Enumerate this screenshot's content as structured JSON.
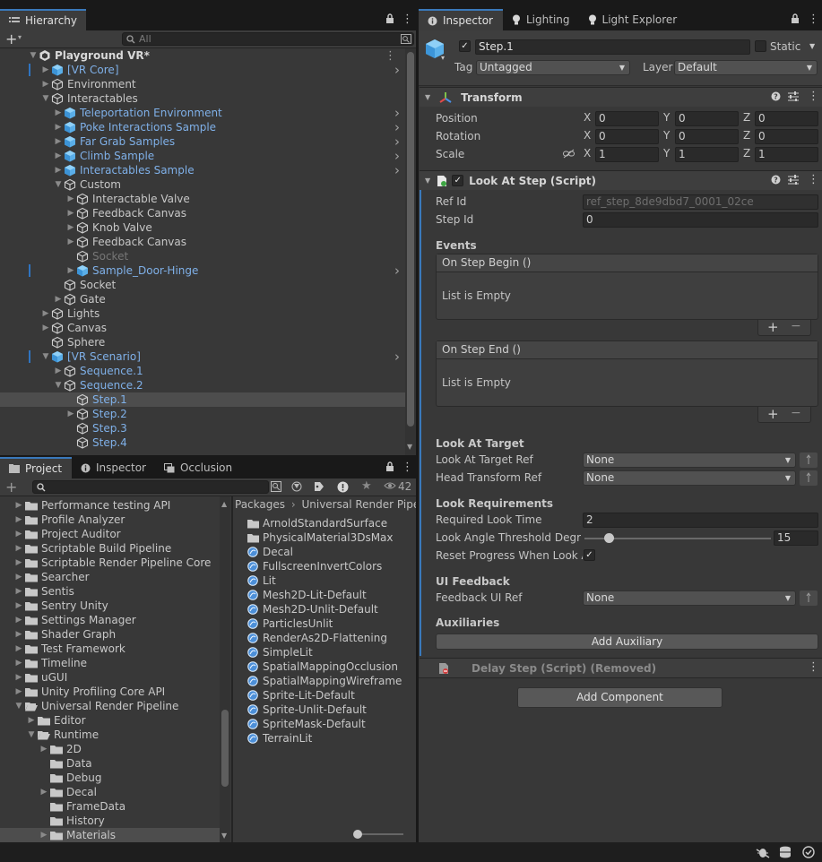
{
  "hierarchy": {
    "tab_label": "Hierarchy",
    "search_placeholder": "All",
    "scene_name": "Playground VR*",
    "rows": [
      {
        "label": "[VR Core]",
        "indent": 1,
        "expand": "closed",
        "icon": "prefab",
        "color": "blue",
        "chevron": true,
        "marker": true
      },
      {
        "label": "Environment",
        "indent": 1,
        "expand": "closed",
        "icon": "object",
        "color": "normal"
      },
      {
        "label": "Interactables",
        "indent": 1,
        "expand": "open",
        "icon": "object",
        "color": "normal"
      },
      {
        "label": "Teleportation Environment",
        "indent": 2,
        "expand": "closed",
        "icon": "prefab",
        "color": "blue",
        "chevron": true
      },
      {
        "label": "Poke Interactions Sample",
        "indent": 2,
        "expand": "closed",
        "icon": "prefab",
        "color": "blue",
        "chevron": true
      },
      {
        "label": "Far Grab Samples",
        "indent": 2,
        "expand": "closed",
        "icon": "prefab",
        "color": "blue",
        "chevron": true
      },
      {
        "label": "Climb Sample",
        "indent": 2,
        "expand": "closed",
        "icon": "prefab",
        "color": "blue",
        "chevron": true
      },
      {
        "label": "Interactables Sample",
        "indent": 2,
        "expand": "closed",
        "icon": "prefab",
        "color": "blue",
        "chevron": true
      },
      {
        "label": "Custom",
        "indent": 2,
        "expand": "open",
        "icon": "object",
        "color": "normal"
      },
      {
        "label": "Interactable Valve",
        "indent": 3,
        "expand": "closed",
        "icon": "object",
        "color": "normal"
      },
      {
        "label": "Feedback Canvas",
        "indent": 3,
        "expand": "closed",
        "icon": "object",
        "color": "normal"
      },
      {
        "label": "Knob Valve",
        "indent": 3,
        "expand": "closed",
        "icon": "object",
        "color": "normal"
      },
      {
        "label": "Feedback Canvas",
        "indent": 3,
        "expand": "closed",
        "icon": "object",
        "color": "normal"
      },
      {
        "label": "Socket",
        "indent": 3,
        "expand": "none",
        "icon": "object",
        "color": "dim"
      },
      {
        "label": "Sample_Door-Hinge",
        "indent": 3,
        "expand": "closed",
        "icon": "prefab",
        "color": "blue",
        "chevron": true,
        "marker": true
      },
      {
        "label": "Socket",
        "indent": 2,
        "expand": "none",
        "icon": "object",
        "color": "normal"
      },
      {
        "label": "Gate",
        "indent": 2,
        "expand": "closed",
        "icon": "object",
        "color": "normal"
      },
      {
        "label": "Lights",
        "indent": 1,
        "expand": "closed",
        "icon": "object",
        "color": "normal"
      },
      {
        "label": "Canvas",
        "indent": 1,
        "expand": "closed",
        "icon": "object",
        "color": "normal"
      },
      {
        "label": "Sphere",
        "indent": 1,
        "expand": "none",
        "icon": "object",
        "color": "normal"
      },
      {
        "label": "[VR Scenario]",
        "indent": 1,
        "expand": "open",
        "icon": "prefab",
        "color": "blue",
        "chevron": true,
        "marker": true
      },
      {
        "label": "Sequence.1",
        "indent": 2,
        "expand": "closed",
        "icon": "object",
        "color": "blue"
      },
      {
        "label": "Sequence.2",
        "indent": 2,
        "expand": "open",
        "icon": "object",
        "color": "blue"
      },
      {
        "label": "Step.1",
        "indent": 3,
        "expand": "none",
        "icon": "object",
        "color": "blue",
        "selected": true
      },
      {
        "label": "Step.2",
        "indent": 3,
        "expand": "closed",
        "icon": "object",
        "color": "blue"
      },
      {
        "label": "Step.3",
        "indent": 3,
        "expand": "none",
        "icon": "object",
        "color": "blue"
      },
      {
        "label": "Step.4",
        "indent": 3,
        "expand": "none",
        "icon": "object",
        "color": "blue"
      }
    ]
  },
  "bottom_tabs": {
    "project": "Project",
    "inspector": "Inspector",
    "occlusion": "Occlusion"
  },
  "project": {
    "badge_count": "42",
    "tree": [
      {
        "label": "Performance testing API",
        "indent": 0,
        "expand": "closed"
      },
      {
        "label": "Profile Analyzer",
        "indent": 0,
        "expand": "closed"
      },
      {
        "label": "Project Auditor",
        "indent": 0,
        "expand": "closed"
      },
      {
        "label": "Scriptable Build Pipeline",
        "indent": 0,
        "expand": "closed"
      },
      {
        "label": "Scriptable Render Pipeline Core",
        "indent": 0,
        "expand": "closed"
      },
      {
        "label": "Searcher",
        "indent": 0,
        "expand": "closed"
      },
      {
        "label": "Sentis",
        "indent": 0,
        "expand": "closed"
      },
      {
        "label": "Sentry Unity",
        "indent": 0,
        "expand": "closed"
      },
      {
        "label": "Settings Manager",
        "indent": 0,
        "expand": "closed"
      },
      {
        "label": "Shader Graph",
        "indent": 0,
        "expand": "closed"
      },
      {
        "label": "Test Framework",
        "indent": 0,
        "expand": "closed"
      },
      {
        "label": "Timeline",
        "indent": 0,
        "expand": "closed"
      },
      {
        "label": "uGUI",
        "indent": 0,
        "expand": "closed"
      },
      {
        "label": "Unity Profiling Core API",
        "indent": 0,
        "expand": "closed"
      },
      {
        "label": "Universal Render Pipeline",
        "indent": 0,
        "expand": "open"
      },
      {
        "label": "Editor",
        "indent": 1,
        "expand": "closed"
      },
      {
        "label": "Runtime",
        "indent": 1,
        "expand": "open"
      },
      {
        "label": "2D",
        "indent": 2,
        "expand": "closed"
      },
      {
        "label": "Data",
        "indent": 2,
        "expand": "none"
      },
      {
        "label": "Debug",
        "indent": 2,
        "expand": "none"
      },
      {
        "label": "Decal",
        "indent": 2,
        "expand": "closed"
      },
      {
        "label": "FrameData",
        "indent": 2,
        "expand": "none"
      },
      {
        "label": "History",
        "indent": 2,
        "expand": "none"
      },
      {
        "label": "Materials",
        "indent": 2,
        "expand": "closed",
        "selected": true
      }
    ],
    "breadcrumb": [
      "Packages",
      "Universal Render Pipeli"
    ],
    "breadcrumb_sep": "›",
    "assets": [
      {
        "label": "ArnoldStandardSurface",
        "icon": "folder"
      },
      {
        "label": "PhysicalMaterial3DsMax",
        "icon": "folder"
      },
      {
        "label": "Decal",
        "icon": "shader"
      },
      {
        "label": "FullscreenInvertColors",
        "icon": "shader"
      },
      {
        "label": "Lit",
        "icon": "shader"
      },
      {
        "label": "Mesh2D-Lit-Default",
        "icon": "shader"
      },
      {
        "label": "Mesh2D-Unlit-Default",
        "icon": "shader"
      },
      {
        "label": "ParticlesUnlit",
        "icon": "shader"
      },
      {
        "label": "RenderAs2D-Flattening",
        "icon": "shader"
      },
      {
        "label": "SimpleLit",
        "icon": "shader"
      },
      {
        "label": "SpatialMappingOcclusion",
        "icon": "shader"
      },
      {
        "label": "SpatialMappingWireframe",
        "icon": "shader"
      },
      {
        "label": "Sprite-Lit-Default",
        "icon": "shader"
      },
      {
        "label": "Sprite-Unlit-Default",
        "icon": "shader"
      },
      {
        "label": "SpriteMask-Default",
        "icon": "shader"
      },
      {
        "label": "TerrainLit",
        "icon": "shader"
      }
    ]
  },
  "inspector": {
    "tabs": {
      "inspector": "Inspector",
      "lighting": "Lighting",
      "light_explorer": "Light Explorer"
    },
    "object_name": "Step.1",
    "static_label": "Static",
    "tag_label": "Tag",
    "tag_value": "Untagged",
    "layer_label": "Layer",
    "layer_value": "Default",
    "transform": {
      "title": "Transform",
      "rows": [
        {
          "label": "Position",
          "x": "0",
          "y": "0",
          "z": "0"
        },
        {
          "label": "Rotation",
          "x": "0",
          "y": "0",
          "z": "0"
        },
        {
          "label": "Scale",
          "x": "1",
          "y": "1",
          "z": "1"
        }
      ],
      "axis_labels": [
        "X",
        "Y",
        "Z"
      ]
    },
    "look_at_step": {
      "title": "Look At Step (Script)",
      "ref_id_label": "Ref Id",
      "ref_id_value": "ref_step_8de9dbd7_0001_02ce",
      "step_id_label": "Step Id",
      "step_id_value": "0",
      "events_label": "Events",
      "on_step_begin": "On Step Begin ()",
      "on_step_end": "On Step End ()",
      "list_empty": "List is Empty",
      "plus": "+",
      "minus": "−",
      "look_at_target_header": "Look At Target",
      "look_at_target_ref_label": "Look At Target Ref",
      "look_at_target_ref_value": "None",
      "head_transform_ref_label": "Head Transform Ref",
      "head_transform_ref_value": "None",
      "look_requirements_header": "Look Requirements",
      "required_look_time_label": "Required Look Time",
      "required_look_time_value": "2",
      "look_angle_label": "Look Angle Threshold Degre",
      "look_angle_value": "15",
      "look_angle_fraction": 0.13,
      "reset_progress_label": "Reset Progress When Look A",
      "ui_feedback_header": "UI Feedback",
      "feedback_ui_ref_label": "Feedback UI Ref",
      "feedback_ui_ref_value": "None",
      "auxiliaries_header": "Auxiliaries",
      "add_auxiliary": "Add Auxiliary"
    },
    "delay_step_title": "Delay Step (Script) (Removed)",
    "add_component": "Add Component"
  },
  "colors": {
    "accent": "#3a79bb",
    "prefab_blue": "#7fb0e8",
    "selection": "#4d4d4d"
  }
}
